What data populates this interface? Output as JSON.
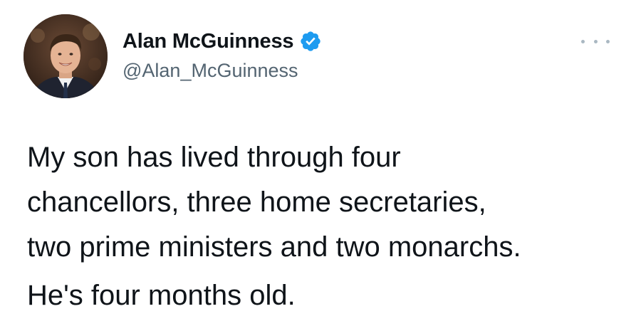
{
  "author": {
    "display_name": "Alan McGuinness",
    "handle": "@Alan_McGuinness",
    "verified": true,
    "verified_icon": "verified-badge-icon"
  },
  "tweet": {
    "text": "My son has lived through four\nchancellors, three home secretaries,\ntwo prime ministers and two monarchs.",
    "follow_up": "He's four months old."
  },
  "colors": {
    "text": "#0f1419",
    "handle": "#536471",
    "verified_badge": "#1d9bf0",
    "more_dots": "#aab8c2"
  }
}
